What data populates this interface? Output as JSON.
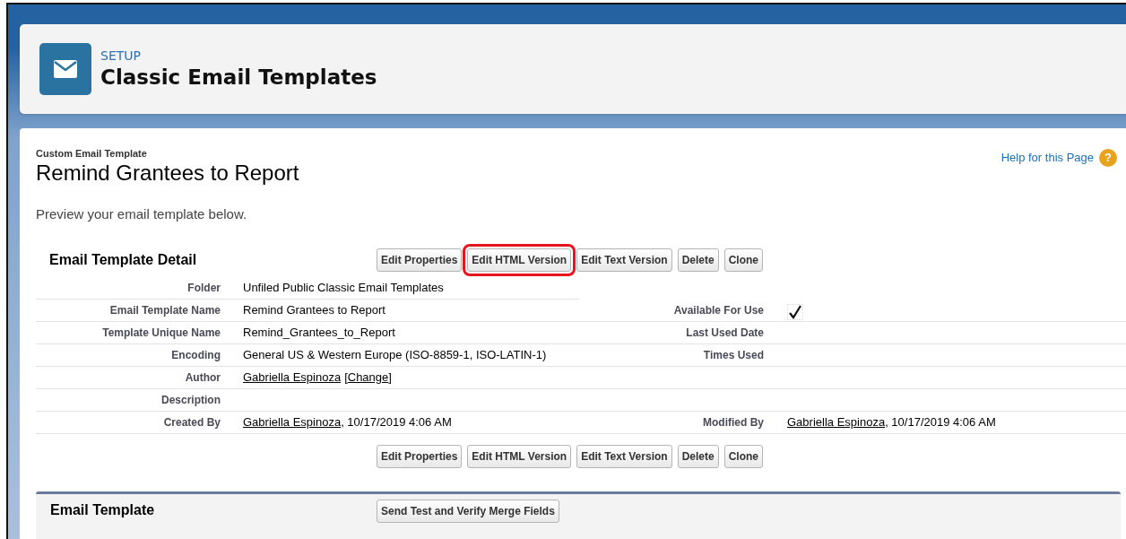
{
  "header": {
    "eyebrow": "SETUP",
    "title": "Classic Email Templates"
  },
  "record": {
    "type_label": "Custom Email Template",
    "title": "Remind Grantees to Report",
    "help_link": "Help for this Page",
    "help_icon": "?",
    "intro": "Preview your email template below."
  },
  "detail": {
    "title": "Email Template Detail",
    "buttons": [
      {
        "label": "Edit Properties",
        "highlighted": false
      },
      {
        "label": "Edit HTML Version",
        "highlighted": true
      },
      {
        "label": "Edit Text Version",
        "highlighted": false
      },
      {
        "label": "Delete",
        "highlighted": false
      },
      {
        "label": "Clone",
        "highlighted": false
      }
    ],
    "rows": [
      {
        "left": {
          "label": "Folder",
          "kind": "text",
          "value": "Unfiled Public Classic Email Templates"
        }
      },
      {
        "left": {
          "label": "Email Template Name",
          "kind": "text",
          "value": "Remind Grantees to Report"
        },
        "right": {
          "label": "Available For Use",
          "kind": "check",
          "checked": true
        }
      },
      {
        "left": {
          "label": "Template Unique Name",
          "kind": "text",
          "value": "Remind_Grantees_to_Report"
        },
        "right": {
          "label": "Last Used Date",
          "kind": "empty"
        }
      },
      {
        "left": {
          "label": "Encoding",
          "kind": "text",
          "value": "General US & Western Europe (ISO-8859-1, ISO-LATIN-1)"
        },
        "right": {
          "label": "Times Used",
          "kind": "empty"
        }
      },
      {
        "left": {
          "label": "Author",
          "kind": "author",
          "link": "Gabriella Espinoza",
          "open": "[",
          "action": "Change",
          "close": "]"
        }
      },
      {
        "left": {
          "label": "Description",
          "kind": "empty"
        }
      },
      {
        "left": {
          "label": "Created By",
          "kind": "link_text",
          "link": "Gabriella Espinoza",
          "text": ", 10/17/2019 4:06 AM"
        },
        "right": {
          "label": "Modified By",
          "kind": "link_text",
          "link": "Gabriella Espinoza",
          "text": ", 10/17/2019 4:06 AM"
        }
      }
    ],
    "bottom_buttons": [
      {
        "label": "Edit Properties"
      },
      {
        "label": "Edit HTML Version"
      },
      {
        "label": "Edit Text Version"
      },
      {
        "label": "Delete"
      },
      {
        "label": "Clone"
      }
    ]
  },
  "email_template": {
    "title": "Email Template",
    "buttons": [
      {
        "label": "Send Test and Verify Merge Fields"
      }
    ]
  }
}
